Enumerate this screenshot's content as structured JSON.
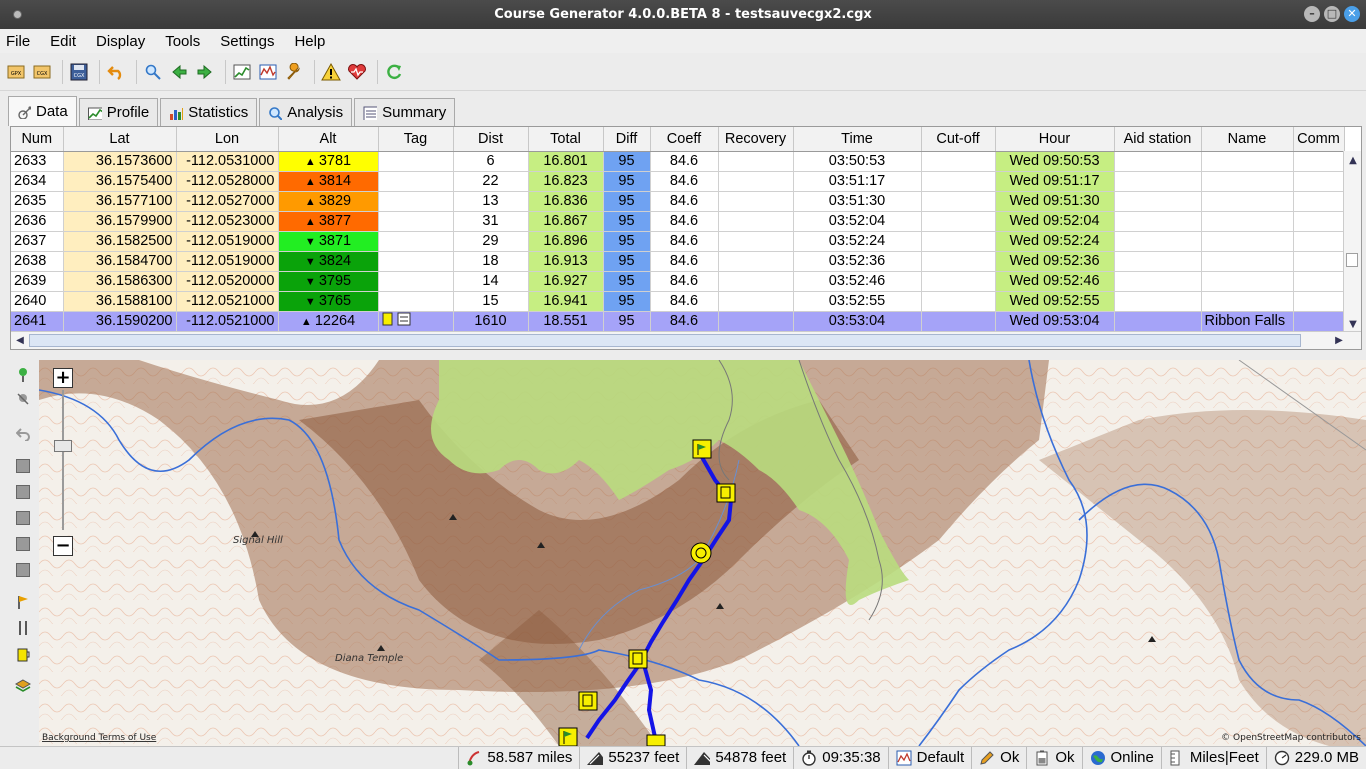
{
  "window": {
    "title": "Course Generator 4.0.0.BETA 8 - testsauvecgx2.cgx"
  },
  "menu": [
    "File",
    "Edit",
    "Display",
    "Tools",
    "Settings",
    "Help"
  ],
  "toolbar": {
    "gpx_label": "GPX",
    "cgx_label": "CGX",
    "cgx2_label": "CGX"
  },
  "tabs": [
    {
      "label": "Data",
      "icon": "satellite-icon"
    },
    {
      "label": "Profile",
      "icon": "profile-chart-icon"
    },
    {
      "label": "Statistics",
      "icon": "statistics-icon"
    },
    {
      "label": "Analysis",
      "icon": "magnifier-icon"
    },
    {
      "label": "Summary",
      "icon": "summary-icon"
    }
  ],
  "table": {
    "columns": [
      "Num",
      "Lat",
      "Lon",
      "Alt",
      "Tag",
      "Dist",
      "Total",
      "Diff",
      "Coeff",
      "Recovery",
      "Time",
      "Cut-off",
      "Hour",
      "Aid station",
      "Name",
      "Comm"
    ],
    "rows": [
      {
        "num": "2633",
        "lat": "36.1573600",
        "lon": "-112.0531000",
        "alt": "3781",
        "trend": "up",
        "altColor": "#ffff00",
        "tag": "",
        "dist": "6",
        "total": "16.801",
        "diff": "95",
        "coeff": "84.6",
        "recovery": "",
        "time": "03:50:53",
        "cutoff": "",
        "hour": "Wed 09:50:53",
        "aid": "",
        "name": "",
        "comm": ""
      },
      {
        "num": "2634",
        "lat": "36.1575400",
        "lon": "-112.0528000",
        "alt": "3814",
        "trend": "up",
        "altColor": "#ff6a00",
        "tag": "",
        "dist": "22",
        "total": "16.823",
        "diff": "95",
        "coeff": "84.6",
        "recovery": "",
        "time": "03:51:17",
        "cutoff": "",
        "hour": "Wed 09:51:17",
        "aid": "",
        "name": "",
        "comm": ""
      },
      {
        "num": "2635",
        "lat": "36.1577100",
        "lon": "-112.0527000",
        "alt": "3829",
        "trend": "up",
        "altColor": "#ff9a00",
        "tag": "",
        "dist": "13",
        "total": "16.836",
        "diff": "95",
        "coeff": "84.6",
        "recovery": "",
        "time": "03:51:30",
        "cutoff": "",
        "hour": "Wed 09:51:30",
        "aid": "",
        "name": "",
        "comm": ""
      },
      {
        "num": "2636",
        "lat": "36.1579900",
        "lon": "-112.0523000",
        "alt": "3877",
        "trend": "up",
        "altColor": "#ff6a00",
        "tag": "",
        "dist": "31",
        "total": "16.867",
        "diff": "95",
        "coeff": "84.6",
        "recovery": "",
        "time": "03:52:04",
        "cutoff": "",
        "hour": "Wed 09:52:04",
        "aid": "",
        "name": "",
        "comm": ""
      },
      {
        "num": "2637",
        "lat": "36.1582500",
        "lon": "-112.0519000",
        "alt": "3871",
        "trend": "down",
        "altColor": "#22ee22",
        "tag": "",
        "dist": "29",
        "total": "16.896",
        "diff": "95",
        "coeff": "84.6",
        "recovery": "",
        "time": "03:52:24",
        "cutoff": "",
        "hour": "Wed 09:52:24",
        "aid": "",
        "name": "",
        "comm": ""
      },
      {
        "num": "2638",
        "lat": "36.1584700",
        "lon": "-112.0519000",
        "alt": "3824",
        "trend": "down",
        "altColor": "#0aa30a",
        "tag": "",
        "dist": "18",
        "total": "16.913",
        "diff": "95",
        "coeff": "84.6",
        "recovery": "",
        "time": "03:52:36",
        "cutoff": "",
        "hour": "Wed 09:52:36",
        "aid": "",
        "name": "",
        "comm": ""
      },
      {
        "num": "2639",
        "lat": "36.1586300",
        "lon": "-112.0520000",
        "alt": "3795",
        "trend": "down",
        "altColor": "#0aa30a",
        "tag": "",
        "dist": "14",
        "total": "16.927",
        "diff": "95",
        "coeff": "84.6",
        "recovery": "",
        "time": "03:52:46",
        "cutoff": "",
        "hour": "Wed 09:52:46",
        "aid": "",
        "name": "",
        "comm": ""
      },
      {
        "num": "2640",
        "lat": "36.1588100",
        "lon": "-112.0521000",
        "alt": "3765",
        "trend": "down",
        "altColor": "#0aa30a",
        "tag": "",
        "dist": "15",
        "total": "16.941",
        "diff": "95",
        "coeff": "84.6",
        "recovery": "",
        "time": "03:52:55",
        "cutoff": "",
        "hour": "Wed 09:52:55",
        "aid": "",
        "name": "",
        "comm": ""
      },
      {
        "num": "2641",
        "lat": "36.1590200",
        "lon": "-112.0521000",
        "alt": "12264",
        "trend": "up",
        "altColor": "#a5a3f8",
        "tag": "drink-icon, note-icon",
        "dist": "1610",
        "total": "18.551",
        "diff": "95",
        "coeff": "84.6",
        "recovery": "",
        "time": "03:53:04",
        "cutoff": "",
        "hour": "Wed 09:53:04",
        "aid": "",
        "name": "Ribbon Falls",
        "comm": "",
        "selected": true
      }
    ]
  },
  "map": {
    "labels": {
      "signal_hill": "Signal Hill",
      "diana_temple": "Diana Temple"
    },
    "attribution_left": "Background Terms of Use",
    "attribution_right": "© OpenStreetMap contributors"
  },
  "sidetools": [
    "add-marker-icon",
    "delete-marker-icon",
    "undo-icon",
    "select-icon",
    "select2-icon",
    "select3-icon",
    "select4-icon",
    "select5-icon",
    "flag-icon",
    "cutlery-icon",
    "drink-icon",
    "layers-icon"
  ],
  "status": {
    "distance": "58.587 miles",
    "climb": "55237 feet",
    "descent": "54878 feet",
    "time": "09:35:38",
    "profile": "Default",
    "check1": "Ok",
    "check2": "Ok",
    "online": "Online",
    "units": "Miles|Feet",
    "memory": "229.0 MB"
  },
  "colors": {
    "total_col": "#c6ee82",
    "lat_col": "#ffeebf",
    "diff_col": "#6fa2f2",
    "hour_col": "#c6ee82",
    "selected_row": "#a5a3f8"
  }
}
